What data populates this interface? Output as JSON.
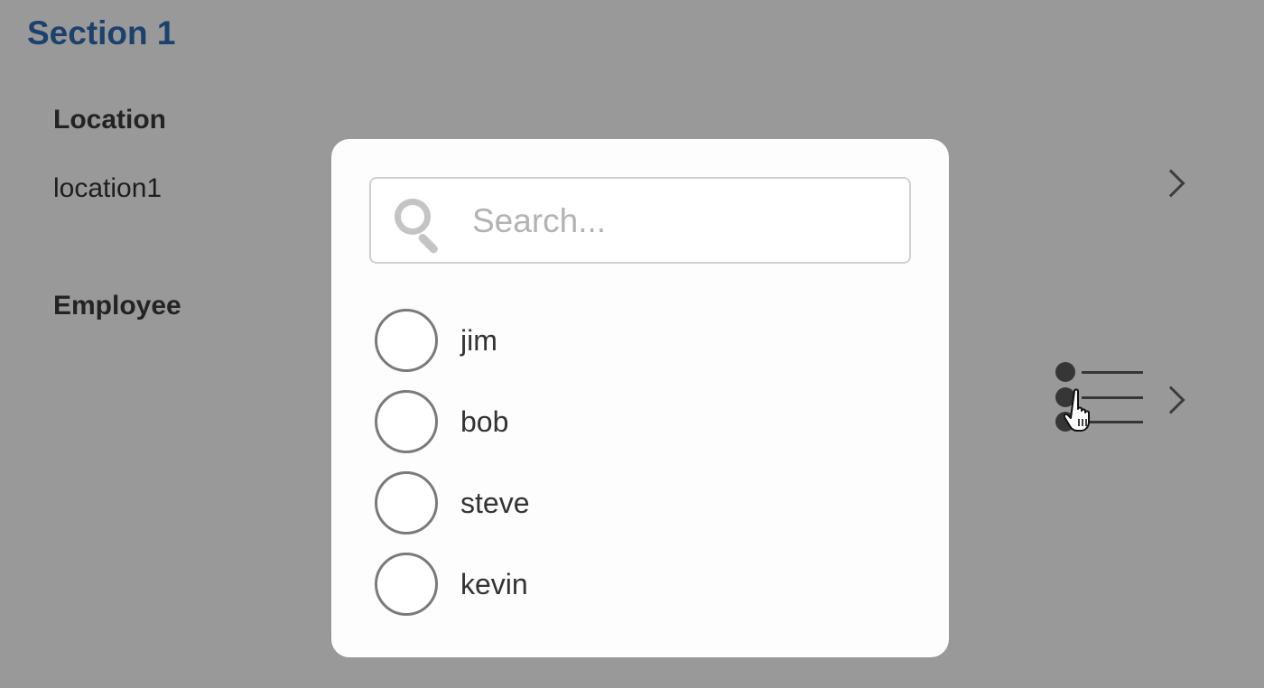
{
  "section": {
    "title": "Section 1"
  },
  "location": {
    "label": "Location",
    "value": "location1"
  },
  "employee": {
    "label": "Employee"
  },
  "dialog": {
    "search": {
      "placeholder": "Search...",
      "value": ""
    },
    "options": [
      {
        "label": "jim",
        "selected": false
      },
      {
        "label": "bob",
        "selected": false
      },
      {
        "label": "steve",
        "selected": false
      },
      {
        "label": "kevin",
        "selected": false
      }
    ]
  },
  "icons": {
    "search": "search-icon",
    "chevron": "chevron-right-icon",
    "list": "list-icon",
    "cursor": "hand-pointer-cursor"
  },
  "colors": {
    "section_title": "#2f6db5",
    "overlay": "rgba(0,0,0,0.40)",
    "dialog_bg": "#fdfdfd",
    "radio_border": "#7a7a7a"
  }
}
